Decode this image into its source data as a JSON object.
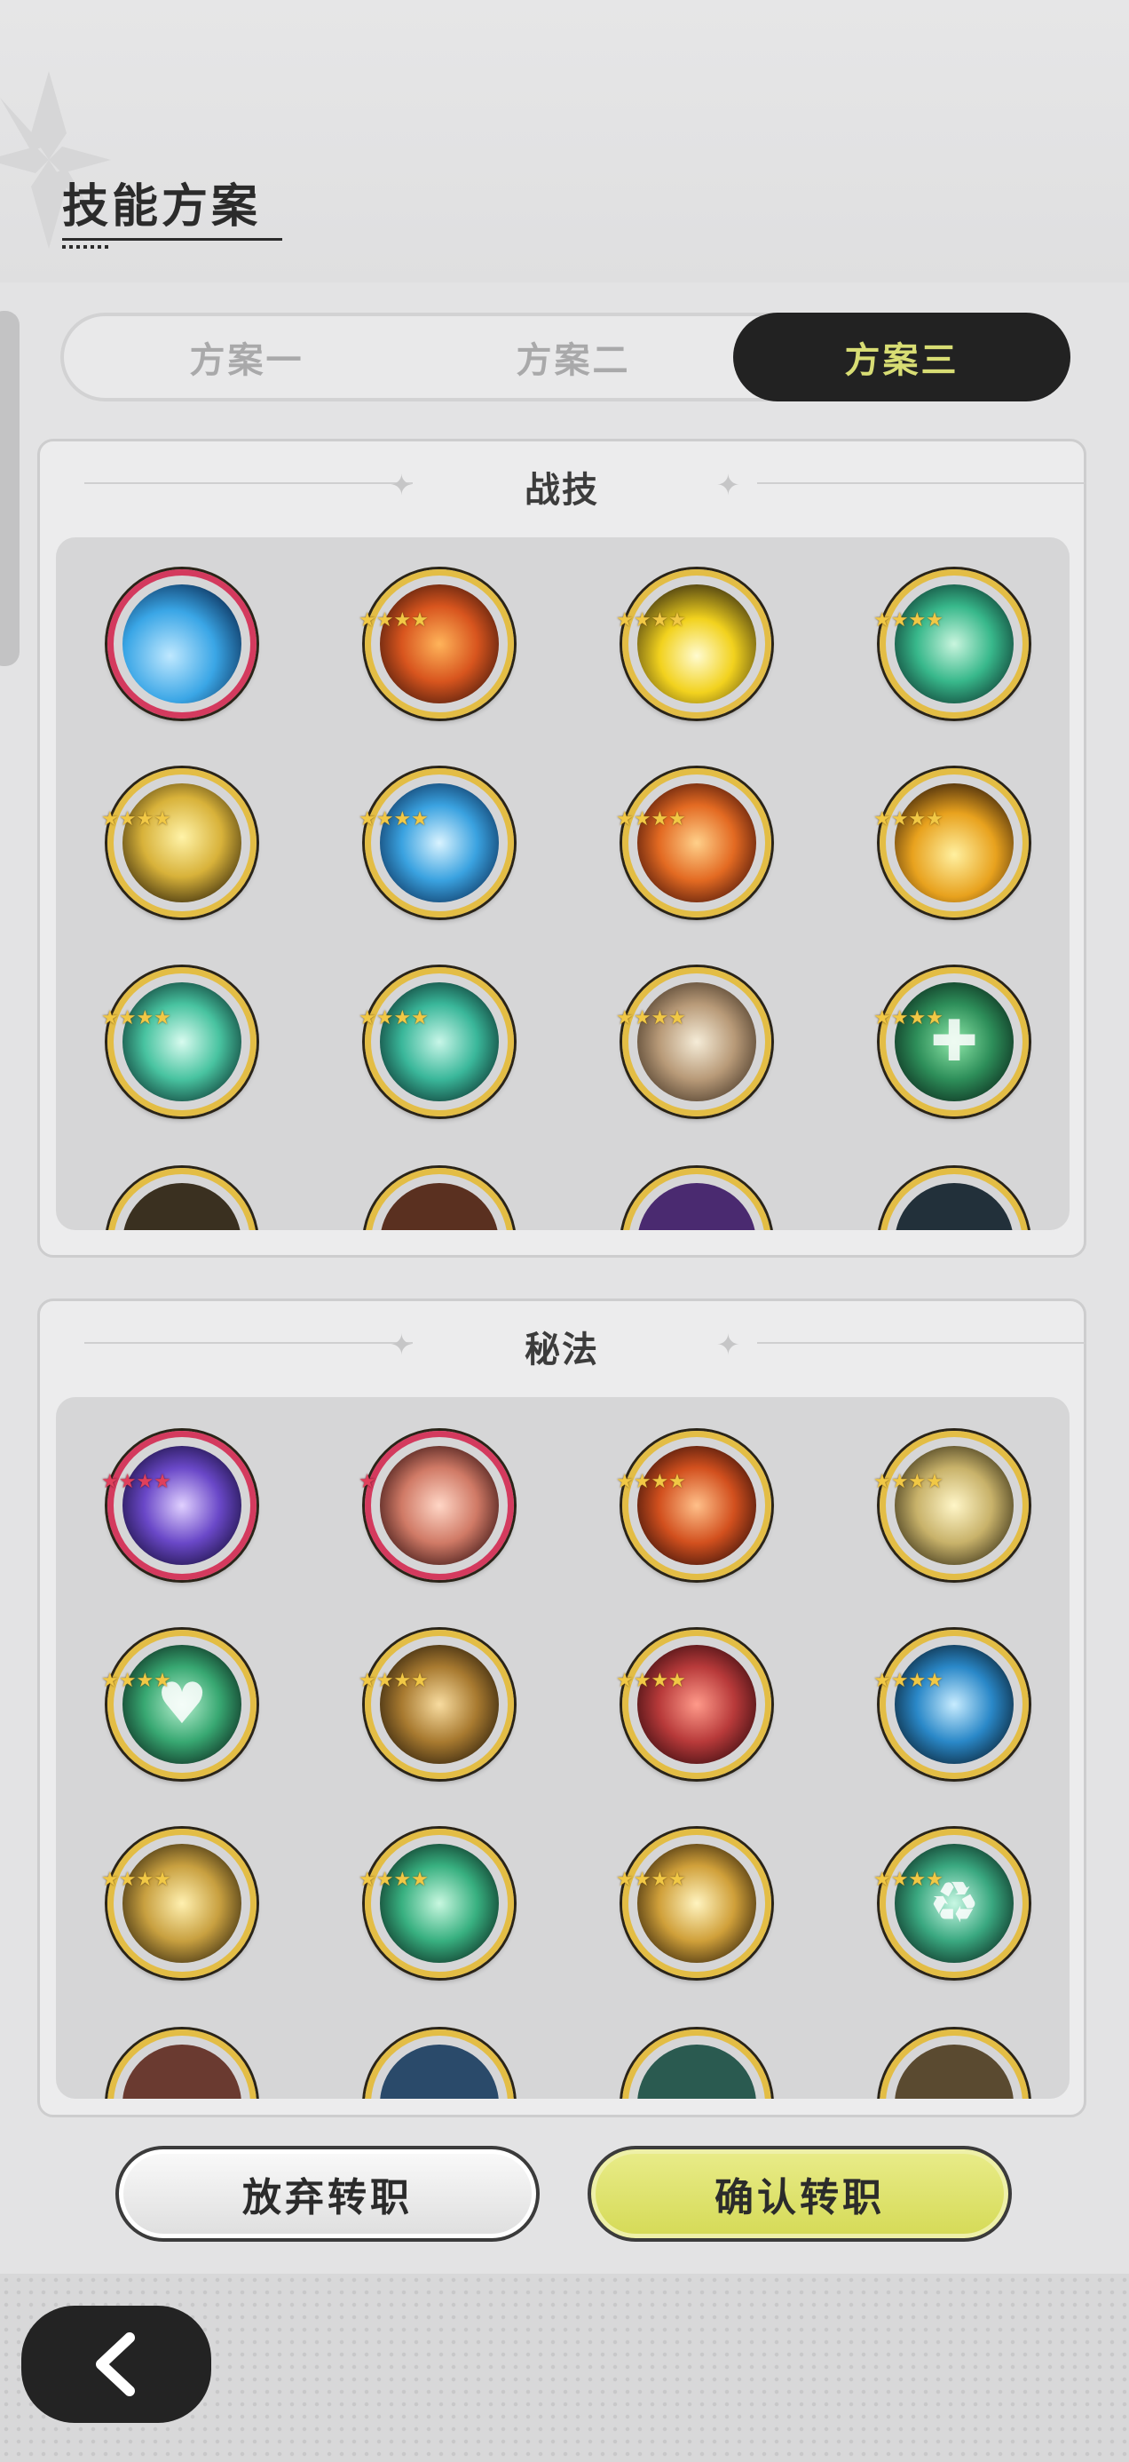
{
  "page": {
    "title": "技能方案"
  },
  "tabs": [
    {
      "label": "方案一",
      "active": false
    },
    {
      "label": "方案二",
      "active": false
    },
    {
      "label": "方案三",
      "active": true
    }
  ],
  "sections": [
    {
      "title": "战技"
    },
    {
      "title": "秘法"
    }
  ],
  "actions": {
    "cancel": "放弃转职",
    "confirm": "确认转职"
  },
  "icons": {
    "back": "chevron-left-icon",
    "header_decoration": "snowflake-icon"
  },
  "colors": {
    "accent": "#d8dd74",
    "tab_active_bg": "#222222",
    "confirm_bg": "#d5da56",
    "rarity_gold": "#e3bd45",
    "rarity_red": "#d43a5e"
  }
}
